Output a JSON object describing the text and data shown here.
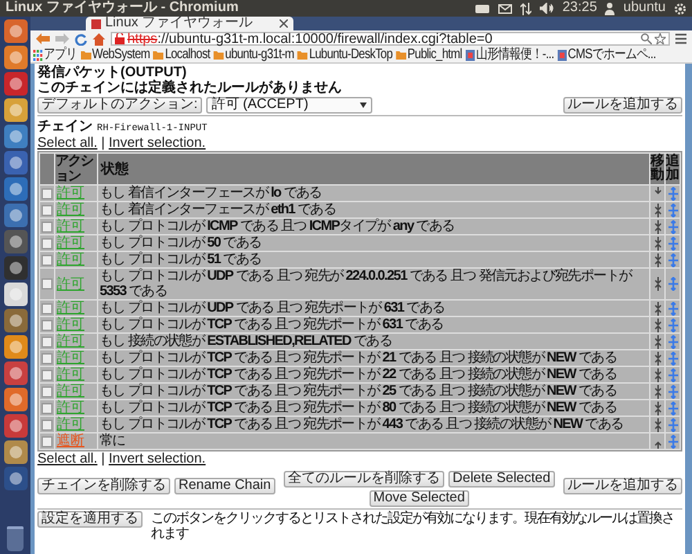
{
  "top_panel": {
    "title": "Linux ファイヤウォール - Chromium",
    "clock": "23:25",
    "user": "ubuntu"
  },
  "browser": {
    "tab": {
      "title": "Linux ファイヤウォール",
      "selected": true
    },
    "url_scheme": "https",
    "url_rest": "://ubuntu-g31t-m.local:10000/firewall/index.cgi?table=0",
    "bookmarks": [
      {
        "label": "アプリ",
        "kind": "apps"
      },
      {
        "label": "WebSystem",
        "kind": "folder"
      },
      {
        "label": "Localhost",
        "kind": "folder"
      },
      {
        "label": "ubuntu-g31t-m",
        "kind": "folder"
      },
      {
        "label": "Lubuntu-DeskTop",
        "kind": "folder"
      },
      {
        "label": "Public_html",
        "kind": "folder"
      },
      {
        "label": "山形情報便！-...",
        "kind": "page"
      },
      {
        "label": "CMSでホームペ...",
        "kind": "page"
      }
    ]
  },
  "output_chain": {
    "title": "発信パケット(OUTPUT)",
    "message": "このチェインには定義されたルールがありません",
    "default_action_button": "デフォルトのアクション:",
    "default_action_value": "許可 (ACCEPT)",
    "add_rule_button": "ルールを追加する"
  },
  "input_chain": {
    "label": "チェイン",
    "name": "RH-Firewall-1-INPUT",
    "select_all": "Select all.",
    "separator": "|",
    "invert_selection": "Invert selection.",
    "columns": [
      "アクション",
      "状態",
      "移動",
      "追加"
    ],
    "rules": [
      {
        "action": "許可",
        "color": "#2ea52e",
        "condition": "もし 着信インターフェースが **lo** である",
        "checked": false,
        "move_up": false,
        "move_down": true
      },
      {
        "action": "許可",
        "color": "#2ea52e",
        "condition": "もし 着信インターフェースが **eth1** である",
        "checked": false,
        "move_up": true,
        "move_down": true
      },
      {
        "action": "許可",
        "color": "#2ea52e",
        "condition": "もし プロトコルが **ICMP** である 且つ **ICMP**タイプが **any** である",
        "checked": false,
        "move_up": true,
        "move_down": true
      },
      {
        "action": "許可",
        "color": "#2ea52e",
        "condition": "もし プロトコルが **50** である",
        "checked": false,
        "move_up": true,
        "move_down": true
      },
      {
        "action": "許可",
        "color": "#2ea52e",
        "condition": "もし プロトコルが **51** である",
        "checked": false,
        "move_up": true,
        "move_down": true
      },
      {
        "action": "許可",
        "color": "#2ea52e",
        "condition": "もし プロトコルが **UDP** である 且つ 宛先が **224.0.0.251** である 且つ 発信元および宛先ポートが **5353** である",
        "checked": false,
        "move_up": true,
        "move_down": true
      },
      {
        "action": "許可",
        "color": "#2ea52e",
        "condition": "もし プロトコルが **UDP** である 且つ 宛先ポートが **631** である",
        "checked": false,
        "move_up": true,
        "move_down": true
      },
      {
        "action": "許可",
        "color": "#2ea52e",
        "condition": "もし プロトコルが **TCP** である 且つ 宛先ポートが **631** である",
        "checked": false,
        "move_up": true,
        "move_down": true
      },
      {
        "action": "許可",
        "color": "#2ea52e",
        "condition": "もし 接続の状態が **ESTABLISHED,RELATED** である",
        "checked": false,
        "move_up": true,
        "move_down": true
      },
      {
        "action": "許可",
        "color": "#2ea52e",
        "condition": "もし プロトコルが **TCP** である 且つ 宛先ポートが **21** である 且つ 接続の状態が **NEW** である",
        "checked": false,
        "move_up": true,
        "move_down": true
      },
      {
        "action": "許可",
        "color": "#2ea52e",
        "condition": "もし プロトコルが **TCP** である 且つ 宛先ポートが **22** である 且つ 接続の状態が **NEW** である",
        "checked": false,
        "move_up": true,
        "move_down": true
      },
      {
        "action": "許可",
        "color": "#2ea52e",
        "condition": "もし プロトコルが **TCP** である 且つ 宛先ポートが **25** である 且つ 接続の状態が **NEW** である",
        "checked": false,
        "move_up": true,
        "move_down": true
      },
      {
        "action": "許可",
        "color": "#2ea52e",
        "condition": "もし プロトコルが **TCP** である 且つ 宛先ポートが **80** である 且つ 接続の状態が **NEW** である",
        "checked": false,
        "move_up": true,
        "move_down": true
      },
      {
        "action": "許可",
        "color": "#2ea52e",
        "condition": "もし プロトコルが **TCP** である 且つ 宛先ポートが **443** である 且つ 接続の状態が **NEW** である",
        "checked": false,
        "move_up": true,
        "move_down": true
      },
      {
        "action": "遮断",
        "color": "#e8561e",
        "condition": "常に",
        "checked": false,
        "move_up": true,
        "move_down": false
      }
    ],
    "select_all_bottom": "Select all.",
    "separator_bottom": "|",
    "invert_selection_bottom": "Invert selection.",
    "delete_chain_button": "チェインを削除する",
    "rename_chain_button": "Rename Chain",
    "delete_all_button": "全てのルールを削除する",
    "delete_selected_button": "Delete Selected",
    "move_selected_button": "Move Selected",
    "add_rule_button": "ルールを追加する"
  },
  "apply": {
    "button": "設定を適用する",
    "text": "このボタンをクリックするとリストされた設定が有効になります。現在有効なルールは置換されます"
  }
}
